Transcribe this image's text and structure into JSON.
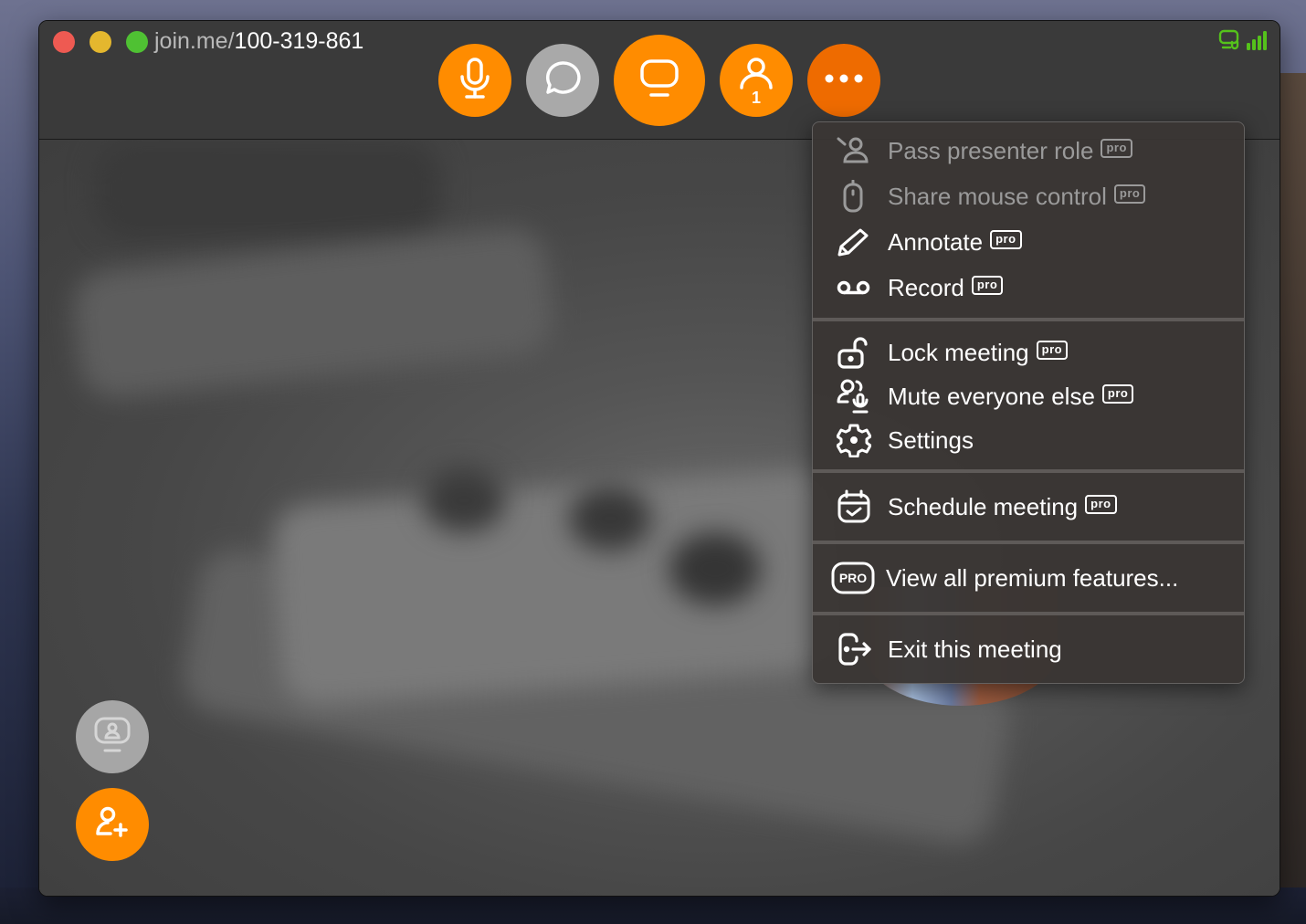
{
  "window": {
    "url_host": "join.me/",
    "meeting_code": "100-319-861",
    "status_icons": [
      "screen-share-audio-icon",
      "signal-strength-icon"
    ],
    "status_color": "#55c21b"
  },
  "toolbar": {
    "buttons": [
      {
        "id": "microphone",
        "icon": "microphone-icon",
        "color": "#ff8c00"
      },
      {
        "id": "chat",
        "icon": "chat-bubble-icon",
        "color": "#a9a9a9"
      },
      {
        "id": "screen-share",
        "icon": "monitor-icon",
        "color": "#ff8c00"
      },
      {
        "id": "participants",
        "icon": "person-icon",
        "color": "#ff8c00",
        "count": "1"
      },
      {
        "id": "more",
        "icon": "more-dots-icon",
        "color": "#ee6b00"
      }
    ]
  },
  "side_buttons": [
    {
      "id": "presenter-view",
      "icon": "monitor-person-icon",
      "color": "#a6a6a6"
    },
    {
      "id": "invite",
      "icon": "add-person-icon",
      "color": "#ff8c00"
    }
  ],
  "menu": {
    "pro_badge": "pro",
    "sections": [
      {
        "items": [
          {
            "label": "Pass presenter role",
            "icon": "pass-presenter-icon",
            "pro": true,
            "disabled": true
          },
          {
            "label": "Share mouse control",
            "icon": "mouse-icon",
            "pro": true,
            "disabled": true
          },
          {
            "label": "Annotate",
            "icon": "pencil-icon",
            "pro": true,
            "disabled": false
          },
          {
            "label": "Record",
            "icon": "voicemail-record-icon",
            "pro": true,
            "disabled": false
          }
        ]
      },
      {
        "items": [
          {
            "label": "Lock meeting",
            "icon": "unlock-icon",
            "pro": true,
            "disabled": false
          },
          {
            "label": "Mute everyone else",
            "icon": "mute-people-icon",
            "pro": true,
            "disabled": false
          },
          {
            "label": "Settings",
            "icon": "gear-icon",
            "pro": false,
            "disabled": false
          }
        ]
      },
      {
        "items": [
          {
            "label": "Schedule meeting",
            "icon": "calendar-check-icon",
            "pro": true,
            "disabled": false
          }
        ]
      },
      {
        "items": [
          {
            "label": "View all premium features...",
            "icon": "pro-icon",
            "icon_text": "PRO",
            "pro": false,
            "disabled": false
          }
        ]
      },
      {
        "items": [
          {
            "label": "Exit this meeting",
            "icon": "exit-icon",
            "pro": false,
            "disabled": false
          }
        ]
      }
    ]
  }
}
